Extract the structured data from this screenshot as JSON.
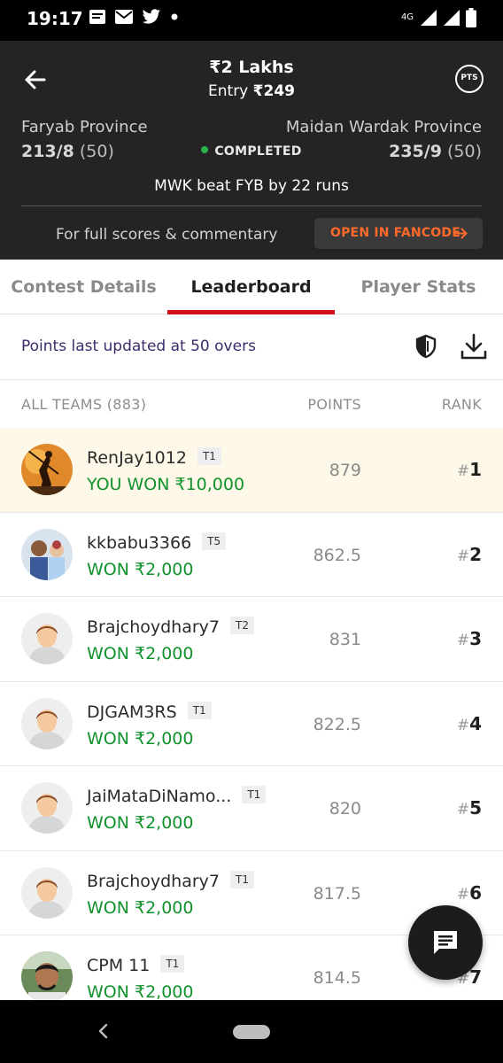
{
  "status_bar": {
    "time": "19:17",
    "network_label": "4G",
    "icons": [
      "message-icon",
      "gmail-icon",
      "twitter-icon",
      "dot-icon",
      "signal-icon",
      "signal-icon-2",
      "battery-icon"
    ]
  },
  "header": {
    "prize": "₹2 Lakhs",
    "entry_prefix": "Entry ",
    "entry_value": "₹249",
    "pts_label": "PTS",
    "team_left": {
      "name": "Faryab Province",
      "score": "213/8",
      "overs": "(50)"
    },
    "team_right": {
      "name": "Maidan Wardak Province",
      "score": "235/9",
      "overs": "(50)"
    },
    "match_status": "COMPLETED",
    "result": "MWK beat FYB by 22 runs",
    "full_scores_text": "For full scores & commentary",
    "fancode_button": "OPEN IN FANCODE"
  },
  "tabs": [
    {
      "label": "Contest Details",
      "active": false
    },
    {
      "label": "Leaderboard",
      "active": true
    },
    {
      "label": "Player Stats",
      "active": false
    }
  ],
  "updated_text": "Points last updated at 50 overs",
  "columns": {
    "teams": "ALL TEAMS (883)",
    "points": "POINTS",
    "rank": "RANK"
  },
  "leaderboard": [
    {
      "name": "RenJay1012",
      "team": "T1",
      "won": "YOU WON ₹10,000",
      "points": "879",
      "rank": "1",
      "avatar": "warrior"
    },
    {
      "name": "kkbabu3366",
      "team": "T5",
      "won": "WON ₹2,000",
      "points": "862.5",
      "rank": "2",
      "avatar": "photo-family"
    },
    {
      "name": "Brajchoydhary7",
      "team": "T2",
      "won": "WON ₹2,000",
      "points": "831",
      "rank": "3",
      "avatar": "default"
    },
    {
      "name": "DJGAM3RS",
      "team": "T1",
      "won": "WON ₹2,000",
      "points": "822.5",
      "rank": "4",
      "avatar": "default"
    },
    {
      "name": "JaiMataDiNamo...",
      "team": "T1",
      "won": "WON ₹2,000",
      "points": "820",
      "rank": "5",
      "avatar": "default"
    },
    {
      "name": "Brajchoydhary7",
      "team": "T1",
      "won": "WON ₹2,000",
      "points": "817.5",
      "rank": "6",
      "avatar": "default"
    },
    {
      "name": "CPM 11",
      "team": "T1",
      "won": "WON ₹2,000",
      "points": "814.5",
      "rank": "7",
      "avatar": "photo-man"
    }
  ],
  "rank_prefix": "#",
  "colors": {
    "header_bg": "#242424",
    "accent_red": "#d3101a",
    "win_green": "#10922c",
    "fancode_orange": "#ff6a2b",
    "highlight_row": "#fdf8e7"
  }
}
